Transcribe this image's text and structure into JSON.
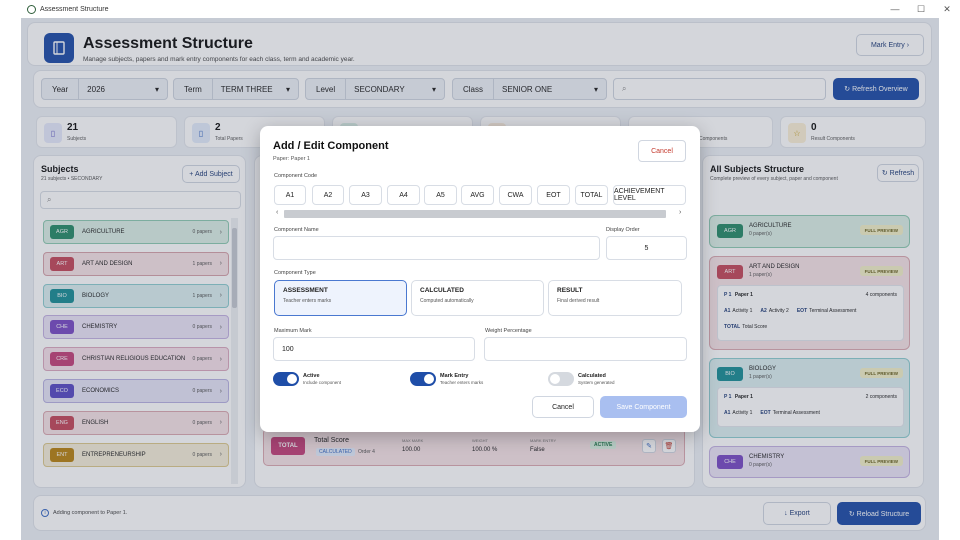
{
  "window": {
    "title": "Assessment Structure",
    "controls": [
      "—",
      "☐",
      "✕"
    ]
  },
  "header": {
    "title": "Assessment Structure",
    "subtitle": "Manage subjects, papers and mark entry components for each class, term and academic year.",
    "mark_entry_label": "Mark Entry ›"
  },
  "filters": {
    "year_label": "Year",
    "year_value": "2026",
    "term_label": "Term",
    "term_value": "TERM THREE",
    "level_label": "Level",
    "level_value": "SECONDARY",
    "class_label": "Class",
    "class_value": "SENIOR ONE",
    "refresh_overview": "↻ Refresh Overview"
  },
  "stats": [
    {
      "value": "21",
      "label": "Subjects",
      "icon": "book-icon"
    },
    {
      "value": "2",
      "label": "Total Papers",
      "icon": "paper-icon"
    },
    {
      "value": "",
      "label": "",
      "icon": "layers-icon"
    },
    {
      "value": "",
      "label": "",
      "icon": "check-icon"
    },
    {
      "value": "",
      "label": "Components",
      "icon": "grid-icon"
    },
    {
      "value": "0",
      "label": "Result Components",
      "icon": "star-icon"
    }
  ],
  "subjects_panel": {
    "title": "Subjects",
    "subtitle": "21 subjects • SECONDARY",
    "add_label": "+ Add Subject",
    "items": [
      {
        "code": "AGR",
        "name": "AGRICULTURE",
        "papers": "0 papers",
        "color": "#2a8c6a",
        "bg": "#dcefe6",
        "border": "#8fcbb2"
      },
      {
        "code": "ART",
        "name": "ART AND DESIGN",
        "papers": "1 papers",
        "color": "#c44a5c",
        "bg": "#f7e3e6",
        "border": "#d7a3ab"
      },
      {
        "code": "BIO",
        "name": "BIOLOGY",
        "papers": "1 papers",
        "color": "#1c8f96",
        "bg": "#dbeff0",
        "border": "#8fcdd0"
      },
      {
        "code": "CHE",
        "name": "CHEMISTRY",
        "papers": "0 papers",
        "color": "#7a4cc4",
        "bg": "#ebe4f6",
        "border": "#c5b3e2"
      },
      {
        "code": "CRE",
        "name": "CHRISTIAN RELIGIOUS EDUCATION",
        "papers": "0 papers",
        "color": "#c4437a",
        "bg": "#f6e1ea",
        "border": "#dba9bf"
      },
      {
        "code": "ECO",
        "name": "ECONOMICS",
        "papers": "0 papers",
        "color": "#5a4cc4",
        "bg": "#e6e4f6",
        "border": "#b9b3e2"
      },
      {
        "code": "ENG",
        "name": "ENGLISH",
        "papers": "0 papers",
        "color": "#c44a5c",
        "bg": "#f7e3e6",
        "border": "#dba9b1"
      },
      {
        "code": "ENT",
        "name": "ENTREPRENEURSHIP",
        "papers": "0 papers",
        "color": "#b98312",
        "bg": "#f5eed9",
        "border": "#ddc98e"
      }
    ]
  },
  "behind_row": {
    "badge": "TOTAL",
    "name": "Total Score",
    "type": "CALCULATED",
    "order": "Order 4",
    "max_label": "MAX MARK",
    "max": "100.00",
    "weight_label": "WEIGHT",
    "weight": "100.00 %",
    "mark_entry_label": "MARK ENTRY",
    "mark_entry": "False",
    "status": "ACTIVE"
  },
  "right_panel": {
    "title": "All Subjects Structure",
    "subtitle": "Complete preview of every subject, paper and component",
    "refresh_label": "↻ Refresh",
    "full_preview": "FULL PREVIEW",
    "agr": {
      "code": "AGR",
      "name": "AGRICULTURE",
      "papers": "0 paper(s)"
    },
    "art": {
      "code": "ART",
      "name": "ART AND DESIGN",
      "papers": "1 paper(s)",
      "paper_tag": "P 1",
      "paper_name": "Paper 1",
      "comp_count": "4 components",
      "components": [
        [
          "A1",
          "Activity 1"
        ],
        [
          "A2",
          "Activity 2"
        ],
        [
          "EOT",
          "Terminal Assessment"
        ],
        [
          "TOTAL",
          "Total Score"
        ]
      ]
    },
    "bio": {
      "code": "BIO",
      "name": "BIOLOGY",
      "papers": "1 paper(s)",
      "paper_tag": "P 1",
      "paper_name": "Paper 1",
      "comp_count": "2 components",
      "components": [
        [
          "A1",
          "Activity 1"
        ],
        [
          "EOT",
          "Terminal Assessment"
        ]
      ]
    },
    "che": {
      "code": "CHE",
      "name": "CHEMISTRY",
      "papers": "0 paper(s)"
    }
  },
  "footer": {
    "status": "Adding component to Paper 1.",
    "export_label": "↓ Export",
    "reload_label": "↻ Reload Structure"
  },
  "modal": {
    "title": "Add / Edit Component",
    "paper": "Paper:  Paper 1",
    "cancel_top": "Cancel",
    "code_label": "Component Code",
    "codes": [
      "A1",
      "A2",
      "A3",
      "A4",
      "A5",
      "AVG",
      "CWA",
      "EOT",
      "TOTAL",
      "ACHIEVEMENT LEVEL"
    ],
    "name_label": "Component Name",
    "name_value": "",
    "order_label": "Display Order",
    "order_value": "5",
    "type_label": "Component Type",
    "types": [
      {
        "title": "ASSESSMENT",
        "sub": "Teacher enters marks"
      },
      {
        "title": "CALCULATED",
        "sub": "Computed automatically"
      },
      {
        "title": "RESULT",
        "sub": "Final derived result"
      }
    ],
    "max_label": "Maximum Mark",
    "max_value": "100",
    "weight_label": "Weight Percentage",
    "weight_value": "",
    "toggles": [
      {
        "title": "Active",
        "sub": "Include component",
        "on": true
      },
      {
        "title": "Mark Entry",
        "sub": "Teacher enters marks",
        "on": true
      },
      {
        "title": "Calculated",
        "sub": "System generated",
        "on": false
      }
    ],
    "cancel_label": "Cancel",
    "save_label": "Save Component"
  }
}
